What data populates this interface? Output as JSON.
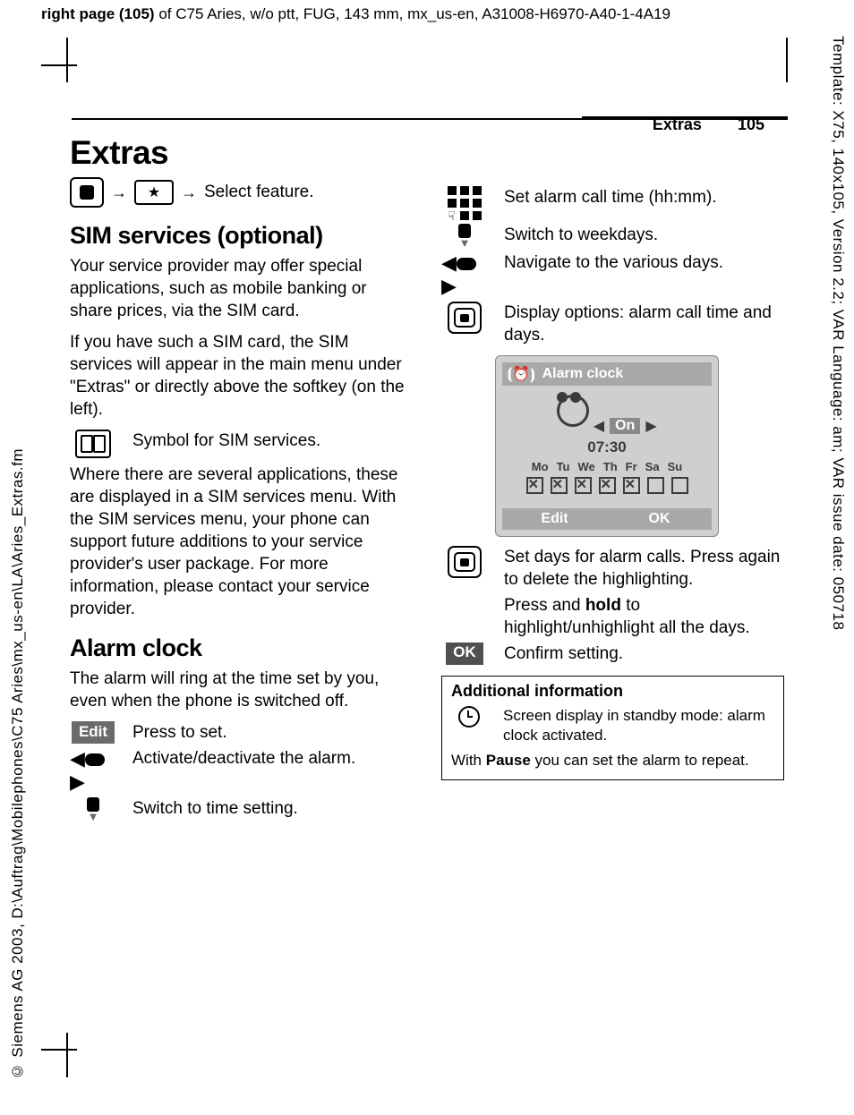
{
  "meta": {
    "header_prefix": "right page (105)",
    "header_rest": " of C75 Aries, w/o ptt, FUG, 143 mm, mx_us-en, A31008-H6970-A40-1-4A19",
    "side_right": "Template: X75, 140x105, Version 2.2; VAR Language: am; VAR issue date: 050718",
    "side_left": "© Siemens AG 2003, D:\\Auftrag\\Mobilephones\\C75 Aries\\mx_us-en\\LA\\Aries_Extras.fm",
    "running_section": "Extras",
    "page_number": "105"
  },
  "left": {
    "h1": "Extras",
    "nav_select": "Select feature.",
    "h2_sim": "SIM services (optional)",
    "sim_p1": "Your service provider may offer special applications, such as mobile banking or share prices, via the SIM card.",
    "sim_p2": "If you have such a SIM card, the SIM services will appear in the main menu under \"Extras\" or directly above the softkey (on the left).",
    "sim_symbol": "Symbol for SIM services.",
    "sim_p3": "Where there are several applications, these are displayed in a SIM services menu. With the SIM services menu, your phone can support future additions to your service provider's user package. For more information, please contact your service provider.",
    "h2_alarm": "Alarm clock",
    "alarm_p": "The alarm will ring at the time set by you, even when the phone is switched off.",
    "edit_label": "Edit",
    "edit_text": "Press to set.",
    "lr_text": "Activate/deactivate the alarm.",
    "down_text": "Switch to time setting."
  },
  "right": {
    "dial_text": "Set alarm call time (hh:mm).",
    "down_text": "Switch to weekdays.",
    "lr_text": "Navigate to the various days.",
    "center_text": "Display options: alarm call time and days.",
    "phone": {
      "title": "Alarm clock",
      "on": "On",
      "time": "07:30",
      "days": [
        "Mo",
        "Tu",
        "We",
        "Th",
        "Fr",
        "Sa",
        "Su"
      ],
      "soft_left": "Edit",
      "soft_right": "OK"
    },
    "center2_text": "Set days for alarm calls. Press again to delete the highlighting.",
    "hold_pre": "Press and ",
    "hold_b": "hold",
    "hold_post": " to highlight/unhighlight all the days.",
    "ok_label": "OK",
    "ok_text": "Confirm setting.",
    "info": {
      "title": "Additional information",
      "row_text": "Screen display in standby mode: alarm clock activated.",
      "pause_pre": "With ",
      "pause_b": "Pause",
      "pause_post": " you can set the alarm to repeat."
    }
  },
  "chart_data": {
    "type": "table",
    "title": "Alarm clock weekday selection",
    "categories": [
      "Mo",
      "Tu",
      "We",
      "Th",
      "Fr",
      "Sa",
      "Su"
    ],
    "values": [
      1,
      1,
      1,
      1,
      1,
      0,
      0
    ],
    "time": "07:30",
    "status": "On"
  }
}
